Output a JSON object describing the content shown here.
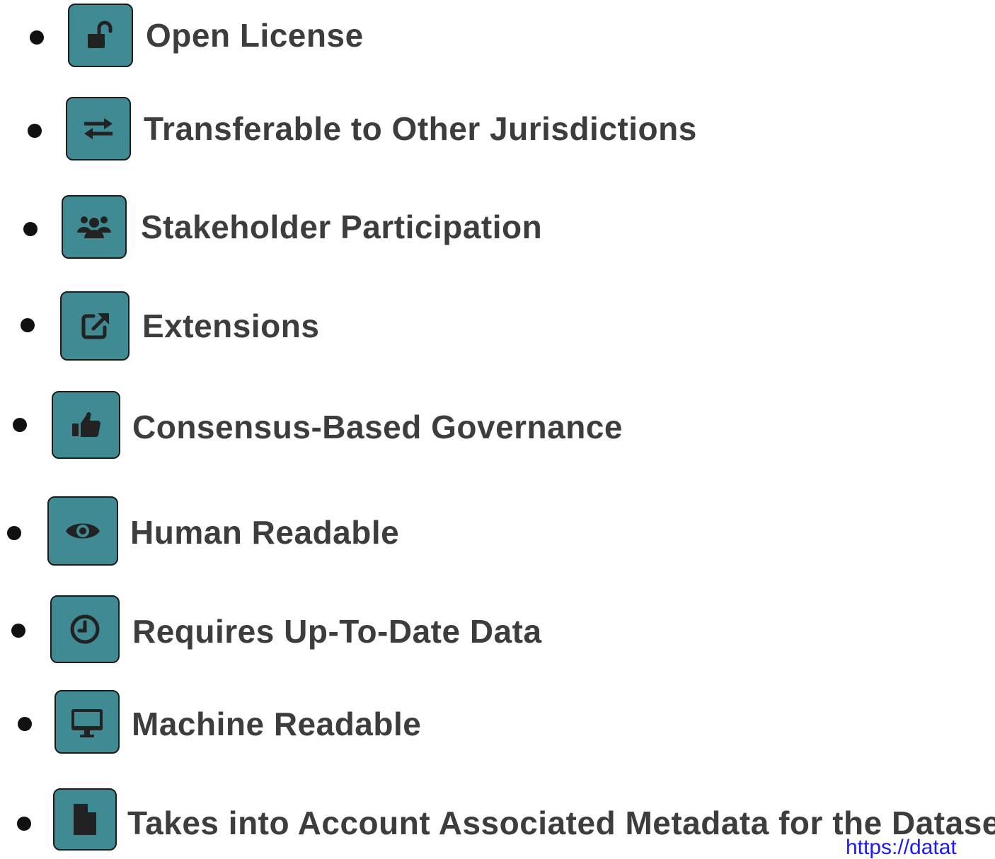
{
  "items": [
    {
      "label": "Open License",
      "icon": "unlock-icon"
    },
    {
      "label": "Transferable to Other Jurisdictions",
      "icon": "exchange-arrows-icon"
    },
    {
      "label": "Stakeholder Participation",
      "icon": "users-group-icon"
    },
    {
      "label": "Extensions",
      "icon": "external-link-icon"
    },
    {
      "label": "Consensus-Based Governance",
      "icon": "thumbs-up-icon"
    },
    {
      "label": "Human Readable",
      "icon": "eye-icon"
    },
    {
      "label": "Requires Up-To-Date Data",
      "icon": "clock-icon"
    },
    {
      "label": "Machine Readable",
      "icon": "monitor-icon"
    },
    {
      "label": "Takes into Account Associated Metadata for the Dataset",
      "icon": "file-icon"
    }
  ],
  "footer": {
    "link_fragment": "https://datat"
  },
  "colors": {
    "icon_background": "#3f8a93",
    "icon_glyph": "#222222",
    "text": "#3d3d3d",
    "link": "#1a1aff"
  }
}
